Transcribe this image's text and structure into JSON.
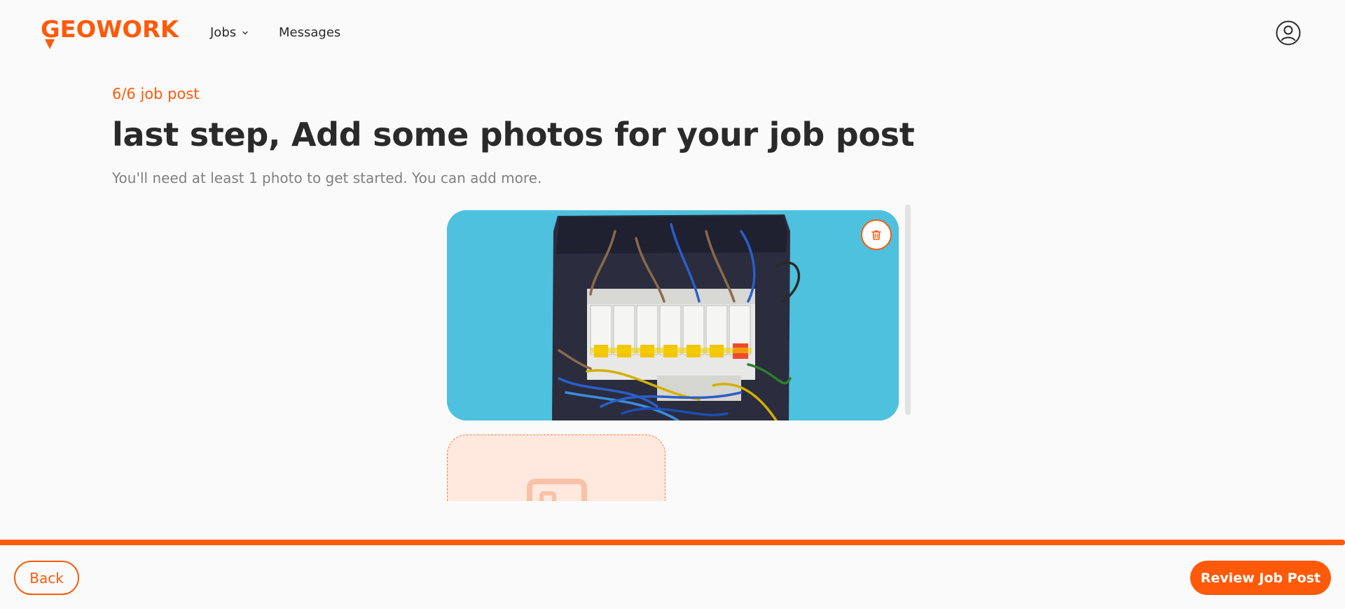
{
  "brand": {
    "name": "GEOWORK",
    "accent_color": "#ff5a0a"
  },
  "nav": {
    "items": [
      {
        "label": "Jobs",
        "has_dropdown": true,
        "icon": "chevron-down-icon"
      },
      {
        "label": "Messages",
        "has_dropdown": false
      }
    ],
    "profile_icon": "user-circle-icon"
  },
  "main": {
    "step": "6/6 job post",
    "title": "last step, Add some photos for your job post",
    "subtitle": "You'll need at least 1 photo to get started. You can add more."
  },
  "photos": {
    "items": [
      {
        "subject": "electrical panel with circuit breakers and wires",
        "delete_icon": "trash-icon"
      }
    ],
    "upload_icon": "image-placeholder-icon"
  },
  "footer": {
    "progress": 1.0,
    "back_label": "Back",
    "review_label": "Review Job Post"
  }
}
